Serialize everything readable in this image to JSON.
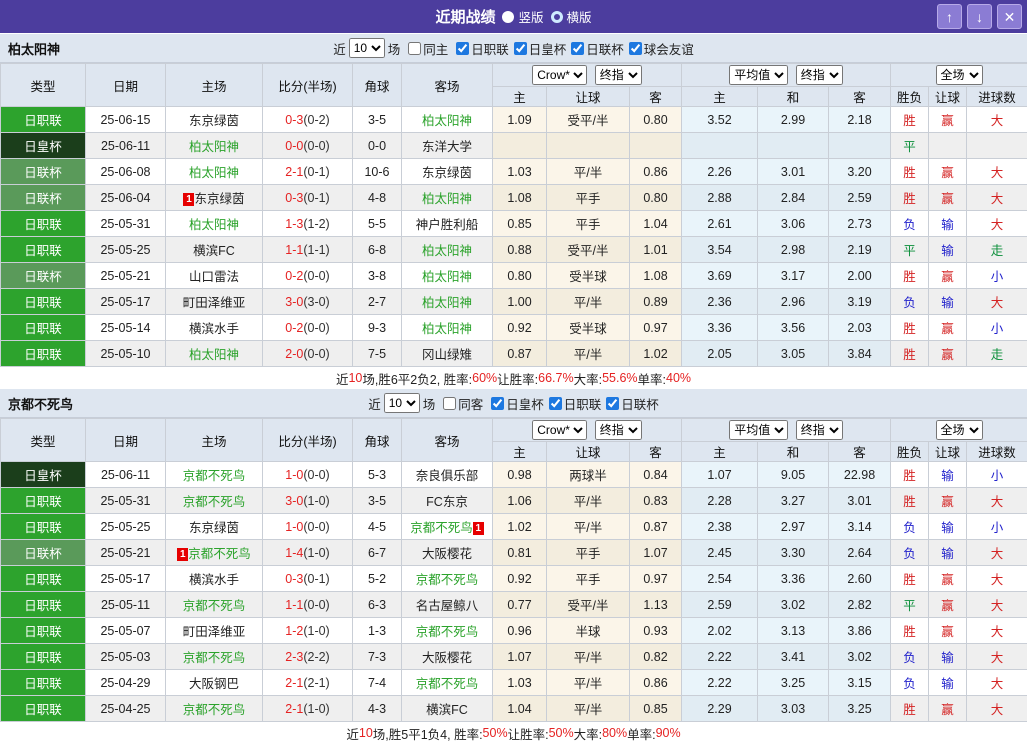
{
  "titlebar": {
    "title": "近期战绩",
    "vertical_label": "竖版",
    "vertical_selected": false,
    "horizontal_label": "横版",
    "horizontal_selected": true,
    "up_glyph": "↑",
    "down_glyph": "↓",
    "close_glyph": "✕"
  },
  "colors": {
    "titlebar_bg": "#4c3d9e",
    "titlebar_button_bg": "#8b7cd4",
    "header_bg": "#dee6f0",
    "league_jleague_green": "#2da32d",
    "league_emperor_cup_dark_green": "#1b3e1b",
    "league_league_cup_mid_green": "#5a9a5a",
    "crow_odds_bg": "#fbf5e9",
    "average_odds_bg": "#e9f4fa",
    "win_red": "#d42424",
    "lose_blue": "#2222cc",
    "draw_green": "#0b8f3a",
    "self_team_green": "#2ca32c",
    "score_red": "#e52222"
  },
  "league_styles": {
    "日职联": "lg-green",
    "日皇杯": "lg-dark",
    "日联杯": "lg-mid"
  },
  "table_header": {
    "main": [
      "类型",
      "日期",
      "主场",
      "比分(半场)",
      "角球",
      "客场"
    ],
    "sub": [
      "主",
      "让球",
      "客",
      "主",
      "和",
      "客",
      "胜负",
      "让球",
      "进球数"
    ],
    "selects": {
      "company": "Crow*",
      "period1": "终指",
      "average": "平均值",
      "period2": "终指",
      "fulltime": "全场"
    }
  },
  "sections": [
    {
      "team": "柏太阳神",
      "filter": {
        "recent_label": "近",
        "count": "10",
        "games_label": "场",
        "same": {
          "label": "同主",
          "checked": false
        },
        "leagues": [
          {
            "label": "日职联",
            "checked": true
          },
          {
            "label": "日皇杯",
            "checked": true
          },
          {
            "label": "日联杯",
            "checked": true
          },
          {
            "label": "球会友谊",
            "checked": true
          }
        ]
      },
      "rows": [
        {
          "league": "日职联",
          "date": "25-06-15",
          "home": {
            "name": "东京绿茵",
            "self": false
          },
          "score": "0-3",
          "half": "(0-2)",
          "corners": "3-5",
          "away": {
            "name": "柏太阳神",
            "self": true
          },
          "crow": [
            "1.09",
            "受平/半",
            "0.80"
          ],
          "avg": [
            "3.52",
            "2.99",
            "2.18"
          ],
          "outcome": [
            {
              "t": "胜",
              "c": "red"
            },
            {
              "t": "赢",
              "c": "red"
            },
            {
              "t": "大",
              "c": "red"
            }
          ]
        },
        {
          "league": "日皇杯",
          "date": "25-06-11",
          "home": {
            "name": "柏太阳神",
            "self": true
          },
          "score": "0-0",
          "half": "(0-0)",
          "corners": "0-0",
          "away": {
            "name": "东洋大学",
            "self": false
          },
          "crow": [
            "",
            "",
            ""
          ],
          "avg": [
            "",
            "",
            ""
          ],
          "outcome": [
            {
              "t": "平",
              "c": "green"
            },
            {
              "t": "",
              "c": ""
            },
            {
              "t": "",
              "c": ""
            }
          ]
        },
        {
          "league": "日联杯",
          "date": "25-06-08",
          "home": {
            "name": "柏太阳神",
            "self": true
          },
          "score": "2-1",
          "half": "(0-1)",
          "corners": "10-6",
          "away": {
            "name": "东京绿茵",
            "self": false
          },
          "crow": [
            "1.03",
            "平/半",
            "0.86"
          ],
          "avg": [
            "2.26",
            "3.01",
            "3.20"
          ],
          "outcome": [
            {
              "t": "胜",
              "c": "red"
            },
            {
              "t": "赢",
              "c": "red"
            },
            {
              "t": "大",
              "c": "red"
            }
          ]
        },
        {
          "league": "日联杯",
          "date": "25-06-04",
          "home": {
            "name": "东京绿茵",
            "self": false,
            "badge": "1",
            "badge_pos": "before"
          },
          "score": "0-3",
          "half": "(0-1)",
          "corners": "4-8",
          "away": {
            "name": "柏太阳神",
            "self": true
          },
          "crow": [
            "1.08",
            "平手",
            "0.80"
          ],
          "avg": [
            "2.88",
            "2.84",
            "2.59"
          ],
          "outcome": [
            {
              "t": "胜",
              "c": "red"
            },
            {
              "t": "赢",
              "c": "red"
            },
            {
              "t": "大",
              "c": "red"
            }
          ]
        },
        {
          "league": "日职联",
          "date": "25-05-31",
          "home": {
            "name": "柏太阳神",
            "self": true
          },
          "score": "1-3",
          "half": "(1-2)",
          "corners": "5-5",
          "away": {
            "name": "神户胜利船",
            "self": false
          },
          "crow": [
            "0.85",
            "平手",
            "1.04"
          ],
          "avg": [
            "2.61",
            "3.06",
            "2.73"
          ],
          "outcome": [
            {
              "t": "负",
              "c": "blue"
            },
            {
              "t": "输",
              "c": "blue"
            },
            {
              "t": "大",
              "c": "red"
            }
          ]
        },
        {
          "league": "日职联",
          "date": "25-05-25",
          "home": {
            "name": "横滨FC",
            "self": false
          },
          "score": "1-1",
          "half": "(1-1)",
          "corners": "6-8",
          "away": {
            "name": "柏太阳神",
            "self": true
          },
          "crow": [
            "0.88",
            "受平/半",
            "1.01"
          ],
          "avg": [
            "3.54",
            "2.98",
            "2.19"
          ],
          "outcome": [
            {
              "t": "平",
              "c": "green"
            },
            {
              "t": "输",
              "c": "blue"
            },
            {
              "t": "走",
              "c": "green"
            }
          ]
        },
        {
          "league": "日联杯",
          "date": "25-05-21",
          "home": {
            "name": "山口雷法",
            "self": false
          },
          "score": "0-2",
          "half": "(0-0)",
          "corners": "3-8",
          "away": {
            "name": "柏太阳神",
            "self": true
          },
          "crow": [
            "0.80",
            "受半球",
            "1.08"
          ],
          "avg": [
            "3.69",
            "3.17",
            "2.00"
          ],
          "outcome": [
            {
              "t": "胜",
              "c": "red"
            },
            {
              "t": "赢",
              "c": "red"
            },
            {
              "t": "小",
              "c": "blue"
            }
          ]
        },
        {
          "league": "日职联",
          "date": "25-05-17",
          "home": {
            "name": "町田泽维亚",
            "self": false
          },
          "score": "3-0",
          "half": "(3-0)",
          "corners": "2-7",
          "away": {
            "name": "柏太阳神",
            "self": true
          },
          "crow": [
            "1.00",
            "平/半",
            "0.89"
          ],
          "avg": [
            "2.36",
            "2.96",
            "3.19"
          ],
          "outcome": [
            {
              "t": "负",
              "c": "blue"
            },
            {
              "t": "输",
              "c": "blue"
            },
            {
              "t": "大",
              "c": "red"
            }
          ]
        },
        {
          "league": "日职联",
          "date": "25-05-14",
          "home": {
            "name": "横滨水手",
            "self": false
          },
          "score": "0-2",
          "half": "(0-0)",
          "corners": "9-3",
          "away": {
            "name": "柏太阳神",
            "self": true
          },
          "crow": [
            "0.92",
            "受半球",
            "0.97"
          ],
          "avg": [
            "3.36",
            "3.56",
            "2.03"
          ],
          "outcome": [
            {
              "t": "胜",
              "c": "red"
            },
            {
              "t": "赢",
              "c": "red"
            },
            {
              "t": "小",
              "c": "blue"
            }
          ]
        },
        {
          "league": "日职联",
          "date": "25-05-10",
          "home": {
            "name": "柏太阳神",
            "self": true
          },
          "score": "2-0",
          "half": "(0-0)",
          "corners": "7-5",
          "away": {
            "name": "冈山绿雉",
            "self": false
          },
          "crow": [
            "0.87",
            "平/半",
            "1.02"
          ],
          "avg": [
            "2.05",
            "3.05",
            "3.84"
          ],
          "outcome": [
            {
              "t": "胜",
              "c": "red"
            },
            {
              "t": "赢",
              "c": "red"
            },
            {
              "t": "走",
              "c": "green"
            }
          ]
        }
      ],
      "summary": [
        {
          "t": "近",
          "r": false
        },
        {
          "t": "10",
          "r": true
        },
        {
          "t": "场,胜6平2负2, 胜率:",
          "r": false
        },
        {
          "t": "60%",
          "r": true
        },
        {
          "t": " 让胜率:",
          "r": false
        },
        {
          "t": "66.7%",
          "r": true
        },
        {
          "t": " 大率:",
          "r": false
        },
        {
          "t": "55.6%",
          "r": true
        },
        {
          "t": " 单率:",
          "r": false
        },
        {
          "t": "40%",
          "r": true
        }
      ]
    },
    {
      "team": "京都不死鸟",
      "filter": {
        "recent_label": "近",
        "count": "10",
        "games_label": "场",
        "same": {
          "label": "同客",
          "checked": false
        },
        "leagues": [
          {
            "label": "日皇杯",
            "checked": true
          },
          {
            "label": "日职联",
            "checked": true
          },
          {
            "label": "日联杯",
            "checked": true
          }
        ]
      },
      "rows": [
        {
          "league": "日皇杯",
          "date": "25-06-11",
          "home": {
            "name": "京都不死鸟",
            "self": true
          },
          "score": "1-0",
          "half": "(0-0)",
          "corners": "5-3",
          "away": {
            "name": "奈良俱乐部",
            "self": false
          },
          "crow": [
            "0.98",
            "两球半",
            "0.84"
          ],
          "avg": [
            "1.07",
            "9.05",
            "22.98"
          ],
          "outcome": [
            {
              "t": "胜",
              "c": "red"
            },
            {
              "t": "输",
              "c": "blue"
            },
            {
              "t": "小",
              "c": "blue"
            }
          ]
        },
        {
          "league": "日职联",
          "date": "25-05-31",
          "home": {
            "name": "京都不死鸟",
            "self": true
          },
          "score": "3-0",
          "half": "(1-0)",
          "corners": "3-5",
          "away": {
            "name": "FC东京",
            "self": false
          },
          "crow": [
            "1.06",
            "平/半",
            "0.83"
          ],
          "avg": [
            "2.28",
            "3.27",
            "3.01"
          ],
          "outcome": [
            {
              "t": "胜",
              "c": "red"
            },
            {
              "t": "赢",
              "c": "red"
            },
            {
              "t": "大",
              "c": "red"
            }
          ]
        },
        {
          "league": "日职联",
          "date": "25-05-25",
          "home": {
            "name": "东京绿茵",
            "self": false
          },
          "score": "1-0",
          "half": "(0-0)",
          "corners": "4-5",
          "away": {
            "name": "京都不死鸟",
            "self": true,
            "badge": "1",
            "badge_pos": "after"
          },
          "crow": [
            "1.02",
            "平/半",
            "0.87"
          ],
          "avg": [
            "2.38",
            "2.97",
            "3.14"
          ],
          "outcome": [
            {
              "t": "负",
              "c": "blue"
            },
            {
              "t": "输",
              "c": "blue"
            },
            {
              "t": "小",
              "c": "blue"
            }
          ]
        },
        {
          "league": "日联杯",
          "date": "25-05-21",
          "home": {
            "name": "京都不死鸟",
            "self": true,
            "badge": "1",
            "badge_pos": "before"
          },
          "score": "1-4",
          "half": "(1-0)",
          "corners": "6-7",
          "away": {
            "name": "大阪樱花",
            "self": false
          },
          "crow": [
            "0.81",
            "平手",
            "1.07"
          ],
          "avg": [
            "2.45",
            "3.30",
            "2.64"
          ],
          "outcome": [
            {
              "t": "负",
              "c": "blue"
            },
            {
              "t": "输",
              "c": "blue"
            },
            {
              "t": "大",
              "c": "red"
            }
          ]
        },
        {
          "league": "日职联",
          "date": "25-05-17",
          "home": {
            "name": "横滨水手",
            "self": false
          },
          "score": "0-3",
          "half": "(0-1)",
          "corners": "5-2",
          "away": {
            "name": "京都不死鸟",
            "self": true
          },
          "crow": [
            "0.92",
            "平手",
            "0.97"
          ],
          "avg": [
            "2.54",
            "3.36",
            "2.60"
          ],
          "outcome": [
            {
              "t": "胜",
              "c": "red"
            },
            {
              "t": "赢",
              "c": "red"
            },
            {
              "t": "大",
              "c": "red"
            }
          ]
        },
        {
          "league": "日职联",
          "date": "25-05-11",
          "home": {
            "name": "京都不死鸟",
            "self": true
          },
          "score": "1-1",
          "half": "(0-0)",
          "corners": "6-3",
          "away": {
            "name": "名古屋鲸八",
            "self": false
          },
          "crow": [
            "0.77",
            "受平/半",
            "1.13"
          ],
          "avg": [
            "2.59",
            "3.02",
            "2.82"
          ],
          "outcome": [
            {
              "t": "平",
              "c": "green"
            },
            {
              "t": "赢",
              "c": "red"
            },
            {
              "t": "大",
              "c": "red"
            }
          ]
        },
        {
          "league": "日职联",
          "date": "25-05-07",
          "home": {
            "name": "町田泽维亚",
            "self": false
          },
          "score": "1-2",
          "half": "(1-0)",
          "corners": "1-3",
          "away": {
            "name": "京都不死鸟",
            "self": true
          },
          "crow": [
            "0.96",
            "半球",
            "0.93"
          ],
          "avg": [
            "2.02",
            "3.13",
            "3.86"
          ],
          "outcome": [
            {
              "t": "胜",
              "c": "red"
            },
            {
              "t": "赢",
              "c": "red"
            },
            {
              "t": "大",
              "c": "red"
            }
          ]
        },
        {
          "league": "日职联",
          "date": "25-05-03",
          "home": {
            "name": "京都不死鸟",
            "self": true
          },
          "score": "2-3",
          "half": "(2-2)",
          "corners": "7-3",
          "away": {
            "name": "大阪樱花",
            "self": false
          },
          "crow": [
            "1.07",
            "平/半",
            "0.82"
          ],
          "avg": [
            "2.22",
            "3.41",
            "3.02"
          ],
          "outcome": [
            {
              "t": "负",
              "c": "blue"
            },
            {
              "t": "输",
              "c": "blue"
            },
            {
              "t": "大",
              "c": "red"
            }
          ]
        },
        {
          "league": "日职联",
          "date": "25-04-29",
          "home": {
            "name": "大阪钢巴",
            "self": false
          },
          "score": "2-1",
          "half": "(2-1)",
          "corners": "7-4",
          "away": {
            "name": "京都不死鸟",
            "self": true
          },
          "crow": [
            "1.03",
            "平/半",
            "0.86"
          ],
          "avg": [
            "2.22",
            "3.25",
            "3.15"
          ],
          "outcome": [
            {
              "t": "负",
              "c": "blue"
            },
            {
              "t": "输",
              "c": "blue"
            },
            {
              "t": "大",
              "c": "red"
            }
          ]
        },
        {
          "league": "日职联",
          "date": "25-04-25",
          "home": {
            "name": "京都不死鸟",
            "self": true
          },
          "score": "2-1",
          "half": "(1-0)",
          "corners": "4-3",
          "away": {
            "name": "横滨FC",
            "self": false
          },
          "crow": [
            "1.04",
            "平/半",
            "0.85"
          ],
          "avg": [
            "2.29",
            "3.03",
            "3.25"
          ],
          "outcome": [
            {
              "t": "胜",
              "c": "red"
            },
            {
              "t": "赢",
              "c": "red"
            },
            {
              "t": "大",
              "c": "red"
            }
          ]
        }
      ],
      "summary": [
        {
          "t": "近",
          "r": false
        },
        {
          "t": "10",
          "r": true
        },
        {
          "t": "场,胜5平1负4, 胜率:",
          "r": false
        },
        {
          "t": "50%",
          "r": true
        },
        {
          "t": " 让胜率:",
          "r": false
        },
        {
          "t": "50%",
          "r": true
        },
        {
          "t": " 大率:",
          "r": false
        },
        {
          "t": "80%",
          "r": true
        },
        {
          "t": " 单率:",
          "r": false
        },
        {
          "t": "90%",
          "r": true
        }
      ]
    }
  ]
}
